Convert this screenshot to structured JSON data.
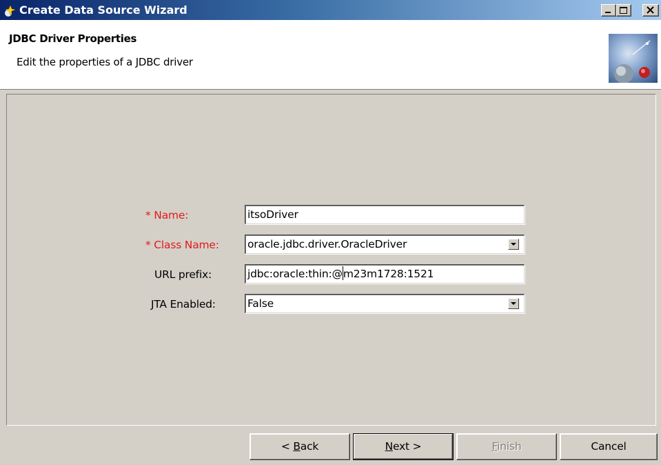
{
  "window": {
    "title": "Create Data Source Wizard",
    "controls": [
      "minimize",
      "maximize",
      "close"
    ]
  },
  "header": {
    "title": "JDBC Driver Properties",
    "description": "Edit the properties of a JDBC driver"
  },
  "form": {
    "name": {
      "required_mark": "*",
      "label": "Name:",
      "value": "itsoDriver"
    },
    "class_name": {
      "required_mark": "*",
      "label": "Class Name:",
      "value": "oracle.jdbc.driver.OracleDriver"
    },
    "url_prefix": {
      "label": "URL prefix:",
      "value_before_caret": "jdbc:oracle:thin:@",
      "value_after_caret": "m23m1728:1521"
    },
    "jta_enabled": {
      "label": "JTA Enabled:",
      "value": "False"
    }
  },
  "buttons": {
    "back": {
      "prefix": "< ",
      "mnemonic": "B",
      "rest": "ack"
    },
    "next": {
      "mnemonic": "N",
      "rest": "ext >"
    },
    "finish": {
      "mnemonic": "F",
      "rest": "inish"
    },
    "cancel": {
      "label": "Cancel"
    }
  },
  "colors": {
    "required_label": "#e01b1b",
    "titlebar_start": "#0a246a",
    "titlebar_end": "#a6caf0",
    "dialog_bg": "#d4d0c8"
  }
}
